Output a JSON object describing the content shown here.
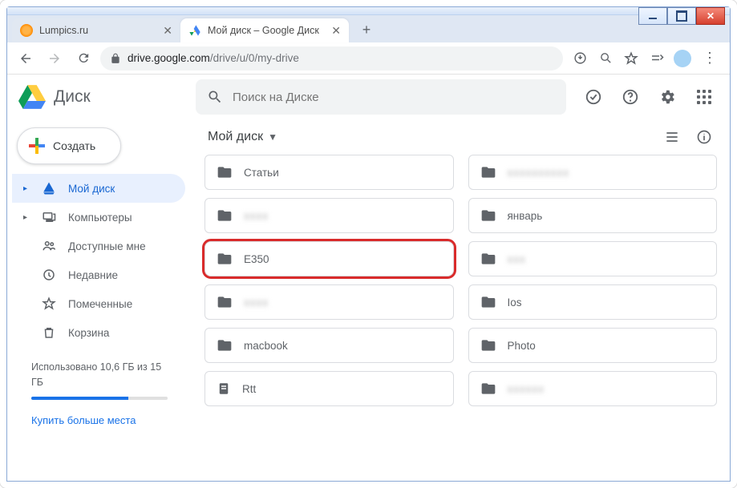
{
  "window": {
    "min_label": "minimize",
    "max_label": "maximize",
    "close_label": "close"
  },
  "tabs": [
    {
      "title": "Lumpics.ru",
      "active": false,
      "favicon": "orange"
    },
    {
      "title": "Мой диск – Google Диск",
      "active": true,
      "favicon": "drive"
    }
  ],
  "newtab_label": "+",
  "addressbar": {
    "domain": "drive.google.com",
    "path": "/drive/u/0/my-drive"
  },
  "drive": {
    "product_name": "Диск",
    "search_placeholder": "Поиск на Диске",
    "create_label": "Создать",
    "breadcrumb": "Мой диск"
  },
  "sidebar": {
    "items": [
      {
        "label": "Мой диск",
        "icon": "drive",
        "expandable": true,
        "active": true
      },
      {
        "label": "Компьютеры",
        "icon": "computers",
        "expandable": true,
        "active": false
      },
      {
        "label": "Доступные мне",
        "icon": "shared",
        "expandable": false,
        "active": false
      },
      {
        "label": "Недавние",
        "icon": "recent",
        "expandable": false,
        "active": false
      },
      {
        "label": "Помеченные",
        "icon": "starred",
        "expandable": false,
        "active": false
      },
      {
        "label": "Корзина",
        "icon": "trash",
        "expandable": false,
        "active": false
      }
    ],
    "storage_text": "Использовано 10,6 ГБ из 15 ГБ",
    "storage_pct": 71,
    "buy_more": "Купить больше места"
  },
  "folders": {
    "col1": [
      {
        "name": "Статьи",
        "icon": "folder",
        "blurred": false,
        "highlighted": false
      },
      {
        "name": "xxxx",
        "icon": "folder",
        "blurred": true,
        "highlighted": false
      },
      {
        "name": "E350",
        "icon": "folder",
        "blurred": false,
        "highlighted": true
      },
      {
        "name": "xxxx",
        "icon": "folder",
        "blurred": true,
        "highlighted": false
      },
      {
        "name": "macbook",
        "icon": "folder",
        "blurred": false,
        "highlighted": false
      },
      {
        "name": "Rtt",
        "icon": "file",
        "blurred": false,
        "highlighted": false
      }
    ],
    "col2": [
      {
        "name": "xxxxxxxxxx",
        "icon": "folder",
        "blurred": true,
        "highlighted": false
      },
      {
        "name": "январь",
        "icon": "folder",
        "blurred": false,
        "highlighted": false
      },
      {
        "name": "xxx",
        "icon": "folder",
        "blurred": true,
        "highlighted": false
      },
      {
        "name": "Ios",
        "icon": "folder",
        "blurred": false,
        "highlighted": false
      },
      {
        "name": "Photo",
        "icon": "folder",
        "blurred": false,
        "highlighted": false
      },
      {
        "name": "xxxxxx",
        "icon": "folder",
        "blurred": true,
        "highlighted": false
      }
    ]
  }
}
